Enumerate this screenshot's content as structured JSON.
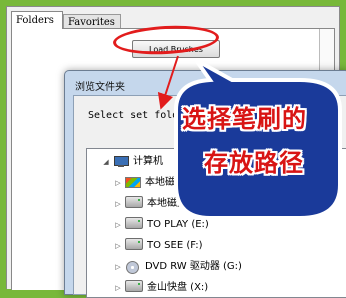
{
  "panel": {
    "tabs": [
      {
        "label": "Folders"
      },
      {
        "label": "Favorites"
      }
    ],
    "load_button_label": "Load Brushes"
  },
  "dialog": {
    "title": "浏览文件夹",
    "prompt": "Select set folder",
    "tree": [
      {
        "label": "计算机",
        "icon": "computer-icon",
        "expanded": true
      },
      {
        "label": "本地磁盘 (C:)",
        "icon": "windows-drive-icon"
      },
      {
        "label": "本地磁盘 (D:)",
        "icon": "drive-icon"
      },
      {
        "label": "TO PLAY (E:)",
        "icon": "drive-icon"
      },
      {
        "label": "TO  SEE (F:)",
        "icon": "drive-icon"
      },
      {
        "label": "DVD RW 驱动器 (G:)",
        "icon": "dvd-icon"
      },
      {
        "label": "金山快盘 (X:)",
        "icon": "drive-icon"
      }
    ]
  },
  "callout": {
    "line1": "选择笔刷的",
    "line2": "存放路径",
    "text_color": "#d81414",
    "bubble_color": "#1a3a9a"
  },
  "colors": {
    "background": "#78b83a",
    "highlight_ellipse": "#e21c1c"
  }
}
